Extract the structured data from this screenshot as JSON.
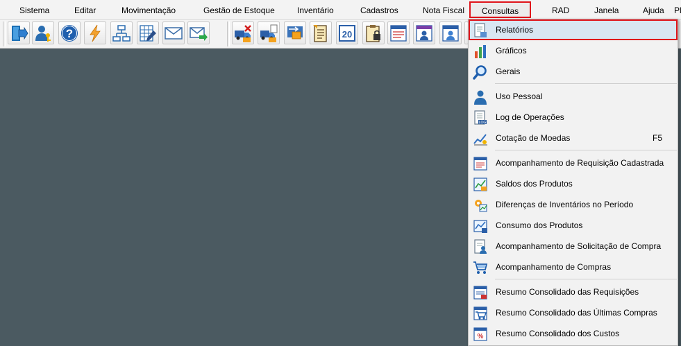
{
  "menubar": {
    "items": [
      {
        "label": "Sistema"
      },
      {
        "label": "Editar"
      },
      {
        "label": "Movimentação"
      },
      {
        "label": "Gestão de Estoque"
      },
      {
        "label": "Inventário"
      },
      {
        "label": "Cadastros"
      },
      {
        "label": "Nota Fiscal"
      },
      {
        "label": "Consultas"
      },
      {
        "label": "RAD"
      },
      {
        "label": "Janela"
      },
      {
        "label": "Ajuda"
      },
      {
        "label": "Pl"
      }
    ]
  },
  "toolbar": {
    "buttons": [
      {
        "icon": "exit-door-icon"
      },
      {
        "icon": "user-key-icon"
      },
      {
        "icon": "help-icon"
      },
      {
        "icon": "lightning-icon"
      },
      {
        "icon": "org-chart-icon"
      },
      {
        "icon": "spreadsheet-pen-icon"
      },
      {
        "icon": "mail-icon"
      },
      {
        "icon": "mail-send-icon"
      },
      {
        "icon": "truck-cancel-icon"
      },
      {
        "icon": "truck-document-icon"
      },
      {
        "icon": "stock-transfer-icon"
      },
      {
        "icon": "inventory-list-icon"
      },
      {
        "icon": "calendar-20-icon"
      },
      {
        "icon": "clipboard-lock-icon"
      },
      {
        "icon": "stock-report-icon"
      },
      {
        "icon": "user-report-icon"
      },
      {
        "icon": "user-report-alt-icon"
      }
    ]
  },
  "dropdown": {
    "items": [
      {
        "label": "Relatórios",
        "icon": "report-icon",
        "shortcut": ""
      },
      {
        "label": "Gráficos",
        "icon": "bar-chart-icon",
        "shortcut": ""
      },
      {
        "label": "Gerais",
        "icon": "magnifier-icon",
        "shortcut": ""
      },
      {
        "label": "Uso Pessoal",
        "icon": "person-icon",
        "shortcut": ""
      },
      {
        "label": "Log de Operações",
        "icon": "log-document-icon",
        "shortcut": ""
      },
      {
        "label": "Cotação de Moedas",
        "icon": "currency-chart-icon",
        "shortcut": "F5"
      },
      {
        "label": "Acompanhamento de Requisição Cadastrada",
        "icon": "requisition-icon",
        "shortcut": ""
      },
      {
        "label": "Saldos dos Produtos",
        "icon": "product-balance-icon",
        "shortcut": ""
      },
      {
        "label": "Diferenças de Inventários no Período",
        "icon": "inventory-diff-icon",
        "shortcut": ""
      },
      {
        "label": "Consumo dos Produtos",
        "icon": "consumption-chart-icon",
        "shortcut": ""
      },
      {
        "label": "Acompanhamento de Solicitação de Compra",
        "icon": "purchase-request-icon",
        "shortcut": ""
      },
      {
        "label": "Acompanhamento de Compras",
        "icon": "shopping-cart-icon",
        "shortcut": ""
      },
      {
        "label": "Resumo Consolidado das Requisições",
        "icon": "requisition-summary-icon",
        "shortcut": ""
      },
      {
        "label": "Resumo Consolidado das Últimas Compras",
        "icon": "purchase-summary-icon",
        "shortcut": ""
      },
      {
        "label": "Resumo Consolidado dos Custos",
        "icon": "cost-summary-icon",
        "shortcut": ""
      }
    ]
  }
}
